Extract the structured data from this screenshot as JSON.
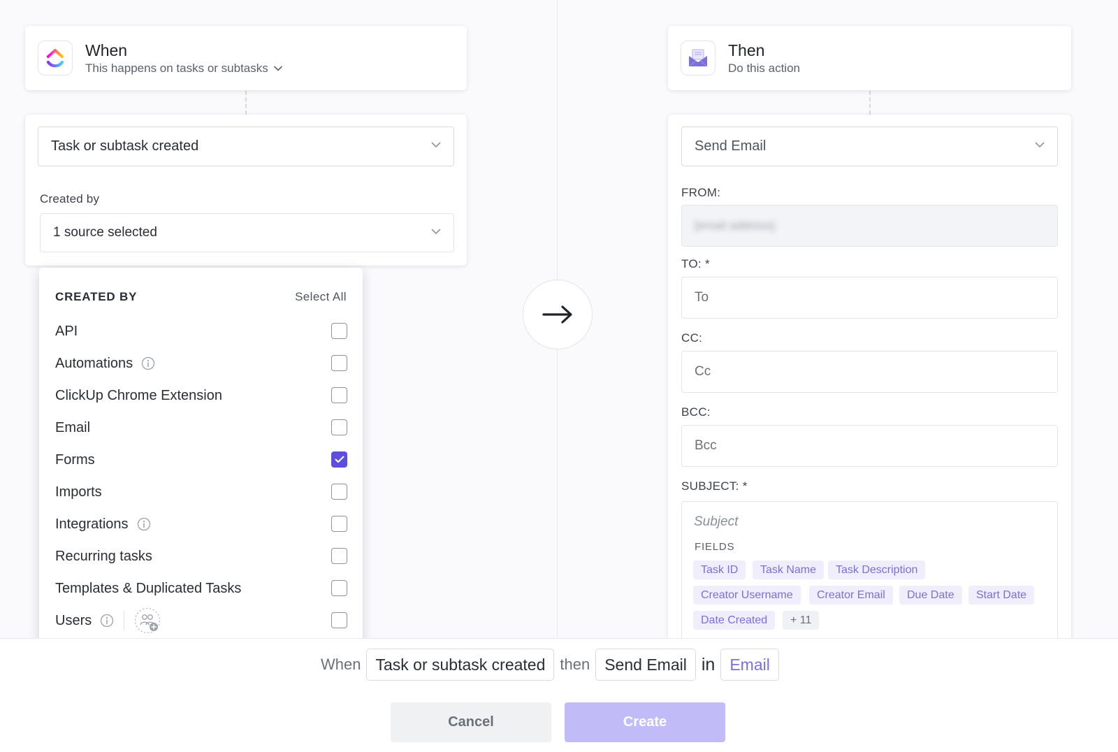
{
  "colors": {
    "accent": "#5d4ee0",
    "chip_bg": "#f0eefc",
    "chip_text": "#7b6fd9",
    "create_button_bg": "#c1bcf7",
    "cancel_button_bg": "#f0f1f3",
    "page_bg": "#fafafc"
  },
  "trigger": {
    "title": "When",
    "subtitle": "This happens on tasks or subtasks",
    "app_icon": "clickup-logo",
    "select_value": "Task or subtask created",
    "created_by_label": "Created by",
    "created_by_value": "1 source selected"
  },
  "dropdown": {
    "title": "CREATED BY",
    "select_all": "Select All",
    "items": [
      {
        "label": "API",
        "checked": false,
        "info": false
      },
      {
        "label": "Automations",
        "checked": false,
        "info": true
      },
      {
        "label": "ClickUp Chrome Extension",
        "checked": false,
        "info": false
      },
      {
        "label": "Email",
        "checked": false,
        "info": false
      },
      {
        "label": "Forms",
        "checked": true,
        "info": false
      },
      {
        "label": "Imports",
        "checked": false,
        "info": false
      },
      {
        "label": "Integrations",
        "checked": false,
        "info": true
      },
      {
        "label": "Recurring tasks",
        "checked": false,
        "info": false
      },
      {
        "label": "Templates & Duplicated Tasks",
        "checked": false,
        "info": false
      },
      {
        "label": "Users",
        "checked": false,
        "info": true
      }
    ]
  },
  "action": {
    "title": "Then",
    "subtitle": "Do this action",
    "app_icon": "email-envelope-icon",
    "select_value": "Send Email",
    "from_label": "FROM:",
    "from_value": "[email address]",
    "to_label": "TO: *",
    "to_placeholder": "To",
    "cc_label": "CC:",
    "cc_placeholder": "Cc",
    "bcc_label": "BCC:",
    "bcc_placeholder": "Bcc",
    "subject_label": "SUBJECT: *",
    "subject_placeholder": "Subject",
    "fields_label": "FIELDS",
    "fields": [
      "Task ID",
      "Task Name",
      "Task Description",
      "Creator Username",
      "Creator Email",
      "Due Date",
      "Start Date",
      "Date Created"
    ],
    "more_fields": "+ 11"
  },
  "summary": {
    "when": "When",
    "trigger": "Task or subtask created",
    "then": "then",
    "action": "Send Email",
    "in": "in",
    "location": "Email"
  },
  "buttons": {
    "cancel": "Cancel",
    "create": "Create"
  }
}
